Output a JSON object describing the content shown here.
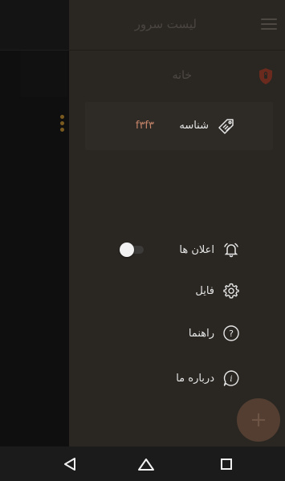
{
  "drawer": {
    "title": "لیست سرور",
    "home_label": "خانه",
    "identifier": {
      "label": "شناسه",
      "value": "f۳f۳"
    },
    "menu": [
      {
        "label": "اعلان ها",
        "icon": "bell-alert-icon",
        "toggle": "on"
      },
      {
        "label": "فایل",
        "icon": "gear-icon"
      },
      {
        "label": "راهنما",
        "icon": "help-circle-icon"
      },
      {
        "label": "درباره ما",
        "icon": "info-bubble-icon"
      }
    ]
  },
  "fab": {
    "symbol": "+"
  },
  "colors": {
    "drawer_bg": "#2a2723",
    "accent": "#c8856a",
    "fab": "#533e31",
    "dots": "#7a5a1f"
  },
  "system_nav": {
    "icons": [
      "back-icon",
      "home-icon",
      "recent-apps-icon"
    ]
  }
}
